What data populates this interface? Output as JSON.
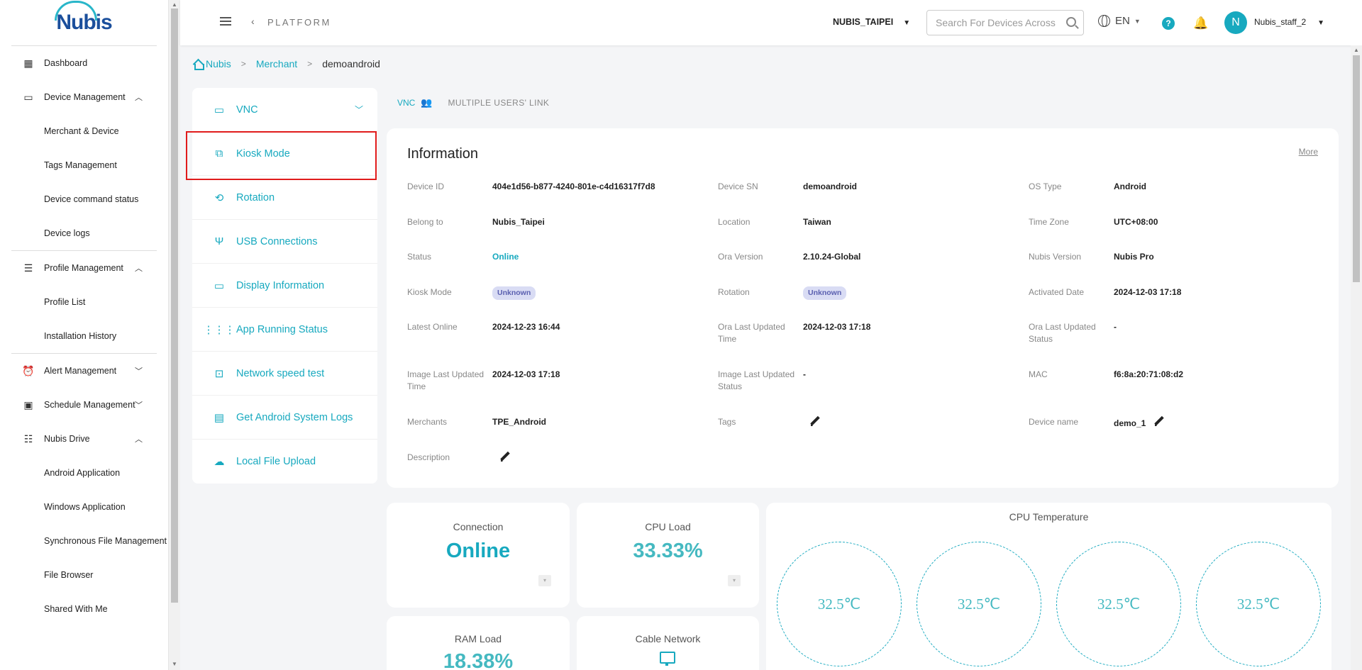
{
  "sidebar": {
    "logo": "Nubis",
    "items": [
      {
        "label": "Dashboard",
        "icon": "dashboard-icon"
      },
      {
        "label": "Device Management",
        "icon": "devices-icon",
        "expanded": true,
        "children": [
          "Merchant & Device",
          "Tags Management",
          "Device command status",
          "Device logs"
        ]
      },
      {
        "label": "Profile Management",
        "icon": "profile-icon",
        "expanded": true,
        "children": [
          "Profile List",
          "Installation History"
        ]
      },
      {
        "label": "Alert Management",
        "icon": "alarm-icon",
        "expanded": false
      },
      {
        "label": "Schedule Management",
        "icon": "calendar-icon",
        "expanded": false
      },
      {
        "label": "Nubis Drive",
        "icon": "list-icon",
        "expanded": true,
        "children": [
          "Android Application",
          "Windows Application",
          "Synchronous File Management",
          "File Browser",
          "Shared With Me"
        ]
      }
    ]
  },
  "header": {
    "platform": "PLATFORM",
    "merchant": "NUBIS_TAIPEI",
    "search_placeholder": "Search For Devices Across",
    "language": "EN",
    "avatar_initial": "N",
    "user": "Nubis_staff_2"
  },
  "breadcrumb": [
    "Nubis",
    "Merchant",
    "demoandroid"
  ],
  "actions": [
    {
      "label": "VNC",
      "icon": "vnc-icon",
      "has_chevron": true
    },
    {
      "label": "Kiosk Mode",
      "icon": "kiosk-icon"
    },
    {
      "label": "Rotation",
      "icon": "rotation-icon"
    },
    {
      "label": "USB Connections",
      "icon": "usb-icon"
    },
    {
      "label": "Display Information",
      "icon": "monitor-icon"
    },
    {
      "label": "App Running Status",
      "icon": "apps-grid-icon"
    },
    {
      "label": "Network speed test",
      "icon": "network-test-icon"
    },
    {
      "label": "Get Android System Logs",
      "icon": "logs-icon"
    },
    {
      "label": "Local File Upload",
      "icon": "cloud-upload-icon"
    }
  ],
  "tabs": {
    "vnc": "VNC",
    "multi": "MULTIPLE USERS' LINK"
  },
  "info": {
    "title": "Information",
    "more": "More",
    "fields": {
      "device_id": {
        "label": "Device ID",
        "value": "404e1d56-b877-4240-801e-c4d16317f7d8"
      },
      "device_sn": {
        "label": "Device SN",
        "value": "demoandroid"
      },
      "os_type": {
        "label": "OS Type",
        "value": "Android"
      },
      "belong_to": {
        "label": "Belong to",
        "value": "Nubis_Taipei"
      },
      "location": {
        "label": "Location",
        "value": "Taiwan"
      },
      "time_zone": {
        "label": "Time Zone",
        "value": "UTC+08:00"
      },
      "status": {
        "label": "Status",
        "value": "Online"
      },
      "ora_version": {
        "label": "Ora Version",
        "value": "2.10.24-Global"
      },
      "nubis_version": {
        "label": "Nubis Version",
        "value": "Nubis Pro"
      },
      "kiosk_mode": {
        "label": "Kiosk Mode",
        "value": "Unknown"
      },
      "rotation": {
        "label": "Rotation",
        "value": "Unknown"
      },
      "activated_date": {
        "label": "Activated Date",
        "value": "2024-12-03 17:18"
      },
      "latest_online": {
        "label": "Latest Online",
        "value": "2024-12-23 16:44"
      },
      "ora_last_updated_time": {
        "label": "Ora Last Updated Time",
        "value": "2024-12-03 17:18"
      },
      "ora_last_updated_status": {
        "label": "Ora Last Updated Status",
        "value": "-"
      },
      "image_last_updated_time": {
        "label": "Image Last Updated Time",
        "value": "2024-12-03 17:18"
      },
      "image_last_updated_status": {
        "label": "Image Last Updated Status",
        "value": "-"
      },
      "mac": {
        "label": "MAC",
        "value": "f6:8a:20:71:08:d2"
      },
      "merchants": {
        "label": "Merchants",
        "value": "TPE_Android"
      },
      "tags": {
        "label": "Tags",
        "value": ""
      },
      "device_name": {
        "label": "Device name",
        "value": "demo_1"
      },
      "description": {
        "label": "Description",
        "value": ""
      }
    }
  },
  "stats": {
    "connection": {
      "title": "Connection",
      "value": "Online"
    },
    "cpu_load": {
      "title": "CPU Load",
      "value": "33.33%"
    },
    "ram_load": {
      "title": "RAM Load",
      "value": "18.38%"
    },
    "cable_network": {
      "title": "Cable Network"
    },
    "cpu_temperature": {
      "title": "CPU Temperature",
      "values": [
        "32.5℃",
        "32.5℃",
        "32.5℃",
        "32.5℃"
      ]
    }
  },
  "colors": {
    "accent": "#17a9bf",
    "highlight": "#e01b1b",
    "badge_bg": "#d9dcf4"
  }
}
